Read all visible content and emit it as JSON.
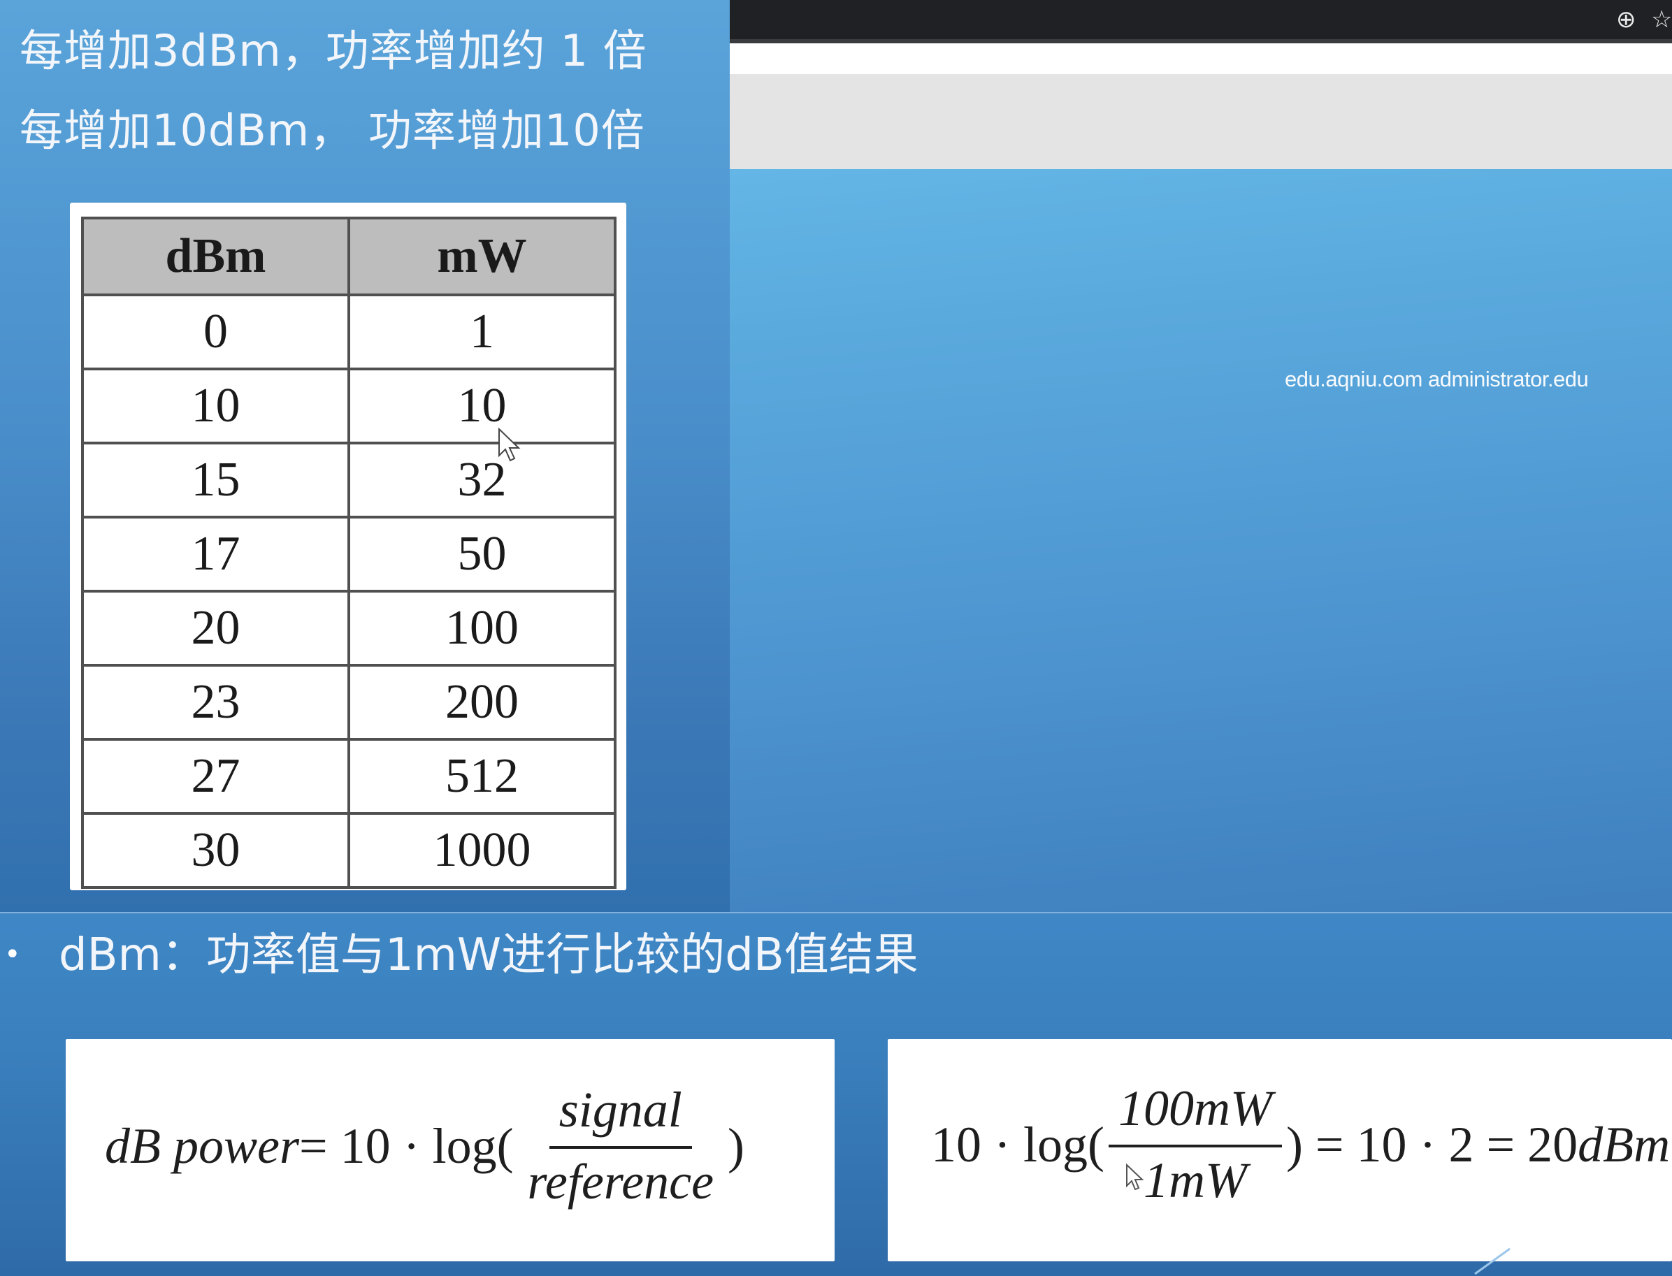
{
  "slide": {
    "rule_3dbm": "每增加3dBm，功率增加约 1 倍",
    "rule_10dbm": "每增加10dBm， 功率增加10倍",
    "table": {
      "headers": [
        "dBm",
        "mW"
      ],
      "rows": [
        [
          "0",
          "1"
        ],
        [
          "10",
          "10"
        ],
        [
          "15",
          "32"
        ],
        [
          "17",
          "50"
        ],
        [
          "20",
          "100"
        ],
        [
          "23",
          "200"
        ],
        [
          "27",
          "512"
        ],
        [
          "30",
          "1000"
        ]
      ]
    },
    "definition_bullet": "•",
    "definition": "dBm：功率值与1mW进行比较的dB值结果",
    "formula_general": {
      "lhs": "dB power",
      "eq_prefix": " = 10 · log(",
      "numerator": "signal",
      "denominator": "reference",
      "close": ")"
    },
    "formula_example": {
      "prefix": "10 · log(",
      "numerator": "100mW",
      "denominator": "1mW",
      "suffix": ") = 10 · 2 = 20",
      "unit": "dBm"
    }
  },
  "browser": {
    "zoom_icon": "zoom-icon",
    "star_icon": "bookmark-star-icon",
    "zoom_glyph": "⊕",
    "star_glyph": "☆",
    "watermark": "edu.aqniu.com administrator.edu"
  },
  "colors": {
    "topbar": "#202124",
    "slide_blue": "#4a8fcb",
    "desktop_blue": "#5aa9dd",
    "table_header": "#bdbdbd"
  }
}
